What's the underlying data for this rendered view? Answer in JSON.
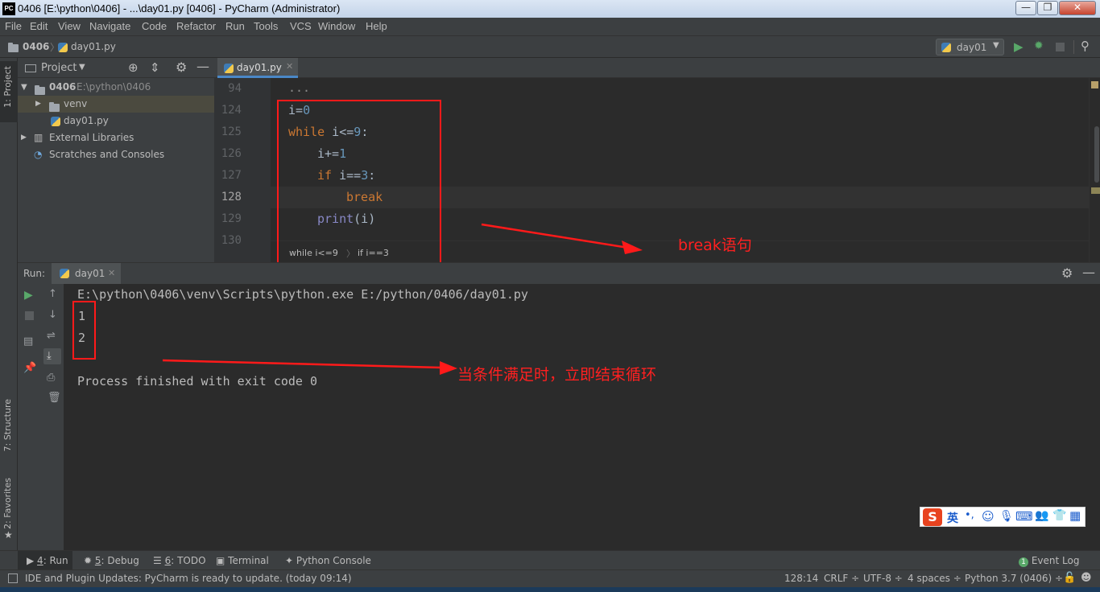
{
  "window": {
    "title": "0406 [E:\\python\\0406] - ...\\day01.py [0406] - PyCharm (Administrator)",
    "logo_text": "PC",
    "minimize": "—",
    "maximize": "❐",
    "close": "✕"
  },
  "menu": [
    "File",
    "Edit",
    "View",
    "Navigate",
    "Code",
    "Refactor",
    "Run",
    "Tools",
    "VCS",
    "Window",
    "Help"
  ],
  "navbar": {
    "crumb_project": "0406",
    "crumb_file": "day01.py",
    "run_config": "day01"
  },
  "left_strip": {
    "project_tab": "1: Project",
    "structure_tab": "7: Structure",
    "favorites_tab": "2: Favorites"
  },
  "project_panel": {
    "title": "Project",
    "tree": [
      {
        "label": "0406",
        "path": "E:\\python\\0406"
      },
      {
        "label": "venv"
      },
      {
        "label": "day01.py"
      },
      {
        "label": "External Libraries"
      },
      {
        "label": "Scratches and Consoles"
      }
    ]
  },
  "editor": {
    "tab_label": "day01.py",
    "folded_text": "...",
    "lines": [
      {
        "num": "94"
      },
      {
        "num": "124"
      },
      {
        "num": "125"
      },
      {
        "num": "126"
      },
      {
        "num": "127"
      },
      {
        "num": "128"
      },
      {
        "num": "129"
      },
      {
        "num": "130"
      }
    ],
    "code": {
      "l124_var": "i",
      "l124_op": "=",
      "l124_val": "0",
      "l125_kw": "while",
      "l125_rest": " i<=",
      "l125_val": "9",
      "l125_colon": ":",
      "l126_rest": "i+=",
      "l126_val": "1",
      "l127_kw": "if",
      "l127_rest": " i==",
      "l127_val": "3",
      "l127_colon": ":",
      "l128_kw": "break",
      "l129_fn": "print",
      "l129_rest": "(i)"
    },
    "breadcrumbs": [
      "while i<=9",
      "if i==3"
    ]
  },
  "run_panel": {
    "label": "Run:",
    "tab_label": "day01",
    "command": "E:\\python\\0406\\venv\\Scripts\\python.exe E:/python/0406/day01.py",
    "outputs": [
      "1",
      "2"
    ],
    "finish": "Process finished with exit code 0"
  },
  "annotations": {
    "break_note": "break语句",
    "loop_note": "当条件满足时，立即结束循环"
  },
  "ime": {
    "badge": "S",
    "lang": "英"
  },
  "bottom_tabs": [
    {
      "key": "4",
      "label": ": Run"
    },
    {
      "key": "5",
      "label": ": Debug"
    },
    {
      "key": "6",
      "label": ": TODO"
    },
    {
      "key": "",
      "label": "Terminal"
    },
    {
      "key": "",
      "label": "Python Console"
    }
  ],
  "event_log": {
    "count": "1",
    "label": "Event Log"
  },
  "status": {
    "message": "IDE and Plugin Updates: PyCharm is ready to update. (today 09:14)",
    "position": "128:14",
    "line_sep": "CRLF ÷",
    "encoding": "UTF-8 ÷",
    "indent": "4 spaces ÷",
    "interpreter": "Python 3.7 (0406) ÷"
  },
  "colors": {
    "accent": "#4a88c7",
    "annotation": "#ff1a1a",
    "keyword": "#cc7832",
    "number": "#6897bb"
  }
}
